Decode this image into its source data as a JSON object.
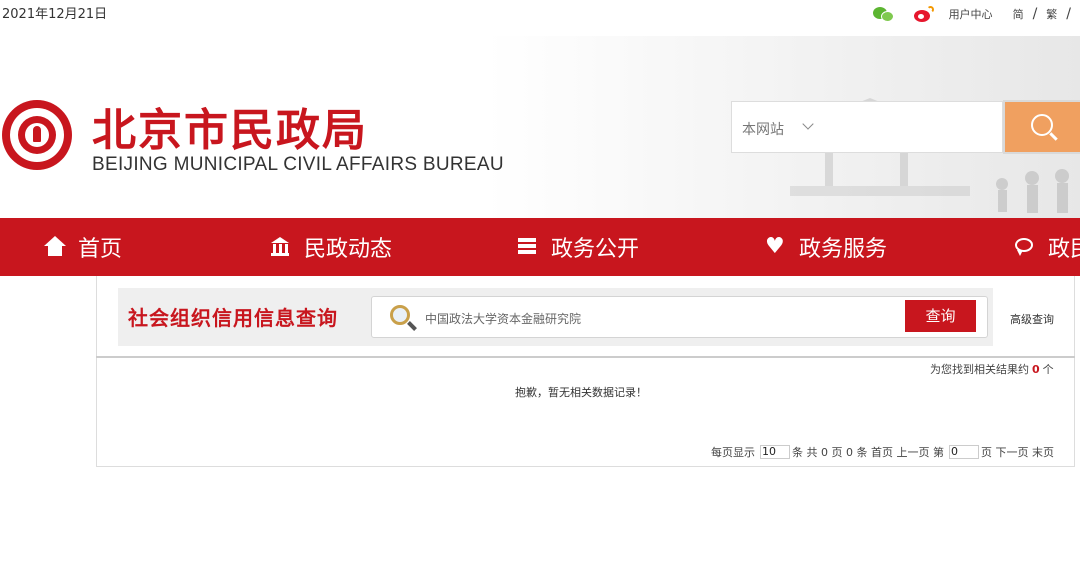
{
  "topbar": {
    "date": "2021年12月21日",
    "user_center": "用户中心",
    "simplified": "简",
    "traditional": "繁",
    "sep": "/",
    "icons": [
      "wechat-icon",
      "weibo-icon"
    ]
  },
  "header": {
    "title_cn": "北京市民政局",
    "title_en": "BEIJING MUNICIPAL CIVIL AFFAIRS BUREAU",
    "search_scope": "本网站",
    "search_placeholder": ""
  },
  "nav": {
    "items": [
      {
        "label": "首页",
        "icon": "home-icon"
      },
      {
        "label": "民政动态",
        "icon": "building-icon"
      },
      {
        "label": "政务公开",
        "icon": "list-icon"
      },
      {
        "label": "政务服务",
        "icon": "heart-icon"
      },
      {
        "label": "政民",
        "icon": "chat-icon"
      }
    ]
  },
  "query": {
    "title": "社会组织信用信息查询",
    "input_value": "中国政法大学资本金融研究院",
    "button_label": "查询",
    "advanced_label": "高级查询"
  },
  "results": {
    "found_prefix": "为您找到相关结果约",
    "count": "0",
    "found_suffix": "个",
    "empty_message": "抱歉，暂无相关数据记录！"
  },
  "pager": {
    "per_page_label": "每页显示",
    "per_page_value": "10",
    "summary": "条 共 0 页 0 条 首页 上一页 第",
    "page_value": "0",
    "tail": "页 下一页 末页"
  },
  "colors": {
    "accent": "#c8161e",
    "search_button": "#f0a060"
  }
}
